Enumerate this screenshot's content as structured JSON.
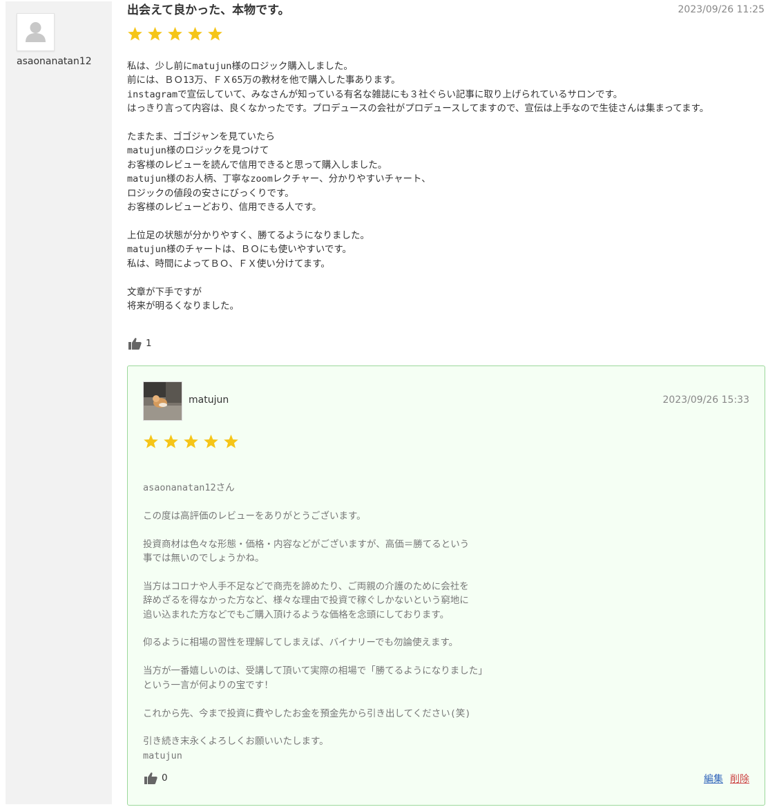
{
  "review": {
    "user": {
      "name": "asaonanatan12",
      "avatar_icon": "default-user-icon"
    },
    "title": "出会えて良かった、本物です。",
    "date": "2023/09/26 11:25",
    "rating": 5,
    "star_color": "#f5c518",
    "body": "私は、少し前にmatujun様のロジック購入しました。\n前には、ＢＯ13万、ＦＸ65万の教材を他で購入した事あります。\ninstagramで宣伝していて、みなさんが知っている有名な雑誌にも３社ぐらい記事に取り上げられているサロンです。\nはっきり言って内容は、良くなかったです。プロデュースの会社がプロデュースしてますので、宣伝は上手なので生徒さんは集まってます。\n\nたまたま、ゴゴジャンを見ていたら\nmatujun様のロジックを見つけて\nお客様のレビューを読んで信用できると思って購入しました。\nmatujun様のお人柄、丁寧なzoomレクチャー、分かりやすいチャート、\nロジックの値段の安さにびっくりです。\nお客様のレビューどおり、信用できる人です。\n\n上位足の状態が分かりやすく、勝てるようになりました。\nmatujun様のチャートは、ＢＯにも使いやすいです。\n私は、時間によってＢＯ、ＦＸ使い分けてます。\n\n文章が下手ですが\n将来が明るくなりました。",
    "like_count": "1",
    "like_icon": "thumbs-up-icon"
  },
  "reply": {
    "author": "matujun",
    "date": "2023/09/26 15:33",
    "rating": 5,
    "border_color": "#9bd79a",
    "background": "#f5fff4",
    "body": "asaonanatan12さん\n\nこの度は高評価のレビューをありがとうございます。\n\n投資商材は色々な形態・価格・内容などがございますが、高価＝勝てるという\n事では無いのでしょうかね。\n\n当方はコロナや人手不足などで商売を諦めたり、ご両親の介護のために会社を\n辞めざるを得なかった方など、様々な理由で投資で稼ぐしかないという窮地に\n追い込まれた方などでもご購入頂けるような価格を念頭にしております。\n\n仰るように相場の習性を理解してしまえば、バイナリーでも勿論使えます。\n\n当方が一番嬉しいのは、受講して頂いて実際の相場で「勝てるようになりました」\nという一言が何よりの宝です！\n\nこれから先、今まで投資に費やしたお金を預金先から引き出してください(笑)\n\n引き続き末永くよろしくお願いいたします。\nmatujun",
    "like_count": "0",
    "edit_label": "編集",
    "delete_label": "削除"
  }
}
